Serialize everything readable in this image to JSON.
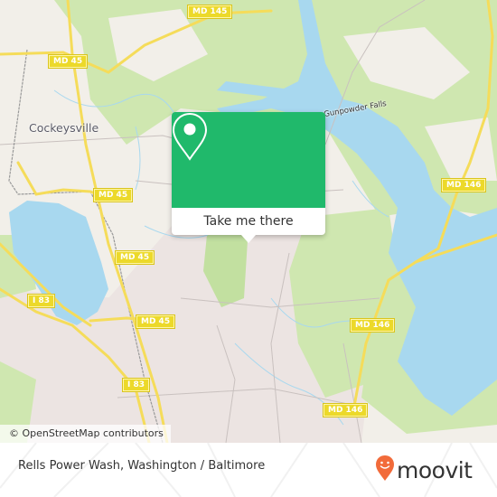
{
  "map": {
    "place_labels": [
      {
        "name": "Cockeysville"
      }
    ],
    "water_labels": [
      {
        "name": "Gunpowder Falls"
      }
    ],
    "road_shields": [
      {
        "label": "MD 145"
      },
      {
        "label": "MD 45"
      },
      {
        "label": "MD 45"
      },
      {
        "label": "MD 45"
      },
      {
        "label": "MD 45"
      },
      {
        "label": "I 83"
      },
      {
        "label": "I 83"
      },
      {
        "label": "MD 146"
      },
      {
        "label": "MD 146"
      },
      {
        "label": "MD 146"
      }
    ],
    "colors": {
      "land": "#f2efe9",
      "urban": "#ece4e2",
      "forest": "#cfe7b0",
      "water": "#a8d8ef",
      "road_major": "#f5dc5a",
      "shield": "#ecd92a"
    }
  },
  "popup": {
    "button_label": "Take me there",
    "icon": "location-pin-icon",
    "color": "#20b96b"
  },
  "attribution": "© OpenStreetMap contributors",
  "footer": {
    "title": "Rells Power Wash, Washington / Baltimore",
    "brand": "moovit",
    "brand_icon": "moovit-smile-pin-icon",
    "brand_color": "#f26b3a"
  }
}
